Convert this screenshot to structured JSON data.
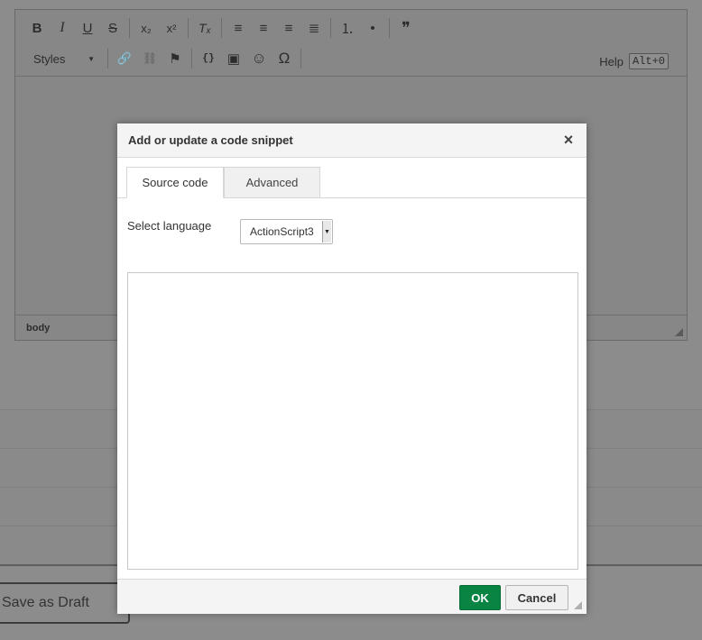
{
  "editor": {
    "toolbar_row1": [
      {
        "icon": "bold-icon",
        "glyph": "B"
      },
      {
        "icon": "italic-icon",
        "glyph": "I"
      },
      {
        "icon": "underline-icon",
        "glyph": "U"
      },
      {
        "icon": "strikethrough-icon",
        "glyph": "S"
      },
      {
        "icon": "subscript-icon",
        "glyph": "x₂"
      },
      {
        "icon": "superscript-icon",
        "glyph": "x²"
      },
      {
        "icon": "clear-formatting-icon",
        "glyph": "Tₓ"
      },
      {
        "icon": "align-left-icon",
        "glyph": "≡"
      },
      {
        "icon": "align-center-icon",
        "glyph": "≡"
      },
      {
        "icon": "align-right-icon",
        "glyph": "≡"
      },
      {
        "icon": "align-justify-icon",
        "glyph": "≣"
      },
      {
        "icon": "numbered-list-icon",
        "glyph": "⒈"
      },
      {
        "icon": "bulleted-list-icon",
        "glyph": "•"
      },
      {
        "icon": "blockquote-icon",
        "glyph": "❞"
      }
    ],
    "styles_label": "Styles",
    "toolbar_row2": [
      {
        "icon": "link-icon",
        "glyph": "🔗"
      },
      {
        "icon": "unlink-icon",
        "glyph": "⛓"
      },
      {
        "icon": "anchor-flag-icon",
        "glyph": "⚑"
      },
      {
        "icon": "code-snippet-icon",
        "glyph": "{}"
      },
      {
        "icon": "image-icon",
        "glyph": "▣"
      },
      {
        "icon": "smiley-icon",
        "glyph": "☺"
      },
      {
        "icon": "special-character-icon",
        "glyph": "Ω"
      }
    ],
    "help_label": "Help",
    "help_shortcut": "Alt+0",
    "status_path": "body"
  },
  "background": {
    "save_draft_label": "Save as Draft"
  },
  "dialog": {
    "title": "Add or update a code snippet",
    "close_glyph": "×",
    "tabs": [
      {
        "label": "Source code",
        "active": true
      },
      {
        "label": "Advanced",
        "active": false
      }
    ],
    "language_label": "Select language",
    "language_value": "ActionScript3",
    "code_value": "",
    "ok_label": "OK",
    "cancel_label": "Cancel"
  },
  "colors": {
    "ok_button": "#0a8443",
    "overlay": "#8c8c8c"
  }
}
